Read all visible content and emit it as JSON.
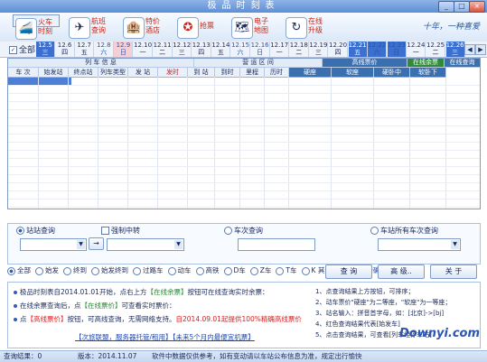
{
  "window": {
    "title": "极品时刻表"
  },
  "toolbar": [
    {
      "label": "火车\n时刻",
      "icon": "train-icon",
      "selected": true
    },
    {
      "label": "航班\n查询",
      "icon": "plane-icon"
    },
    {
      "label": "特价\n酒店",
      "icon": "hotel-icon"
    },
    {
      "label": "抢票",
      "icon": "ticket-icon"
    },
    {
      "label": "电子\n地图",
      "icon": "map-icon"
    },
    {
      "label": "在线\n升级",
      "icon": "upgrade-icon"
    }
  ],
  "brand_slogan": "十年，一种喜爱",
  "date_strip": {
    "all_label": "全部",
    "dates": [
      {
        "d": "12.5",
        "w": "三"
      },
      {
        "d": "12.6",
        "w": "四"
      },
      {
        "d": "12.7",
        "w": "五"
      },
      {
        "d": "12.8",
        "w": "六"
      },
      {
        "d": "12.9",
        "w": "日"
      },
      {
        "d": "12.10",
        "w": "一"
      },
      {
        "d": "12.11",
        "w": "二"
      },
      {
        "d": "12.12",
        "w": "三"
      },
      {
        "d": "12.13",
        "w": "四"
      },
      {
        "d": "12.14",
        "w": "五"
      },
      {
        "d": "12.15",
        "w": "六"
      },
      {
        "d": "12.16",
        "w": "日"
      },
      {
        "d": "12.17",
        "w": "一"
      },
      {
        "d": "12.18",
        "w": "二"
      },
      {
        "d": "12.19",
        "w": "三"
      },
      {
        "d": "12.20",
        "w": "四"
      },
      {
        "d": "12.21",
        "w": "五"
      },
      {
        "d": "12.22",
        "w": "六"
      },
      {
        "d": "12.23",
        "w": "日"
      },
      {
        "d": "12.24",
        "w": "一"
      },
      {
        "d": "12.25",
        "w": "二"
      },
      {
        "d": "12.26",
        "w": "三"
      }
    ]
  },
  "grid": {
    "groups": {
      "train": "列 车 信 息",
      "seg": "营 运 区 间",
      "price": "高线票价",
      "online": "在线余票",
      "query": "在线查询"
    },
    "columns": [
      "车 次",
      "始发站",
      "终点站",
      "列车类型",
      "发 站",
      "发时",
      "到 站",
      "到时",
      "里程",
      "历时",
      "硬座",
      "软座",
      "硬卧中",
      "软卧下"
    ]
  },
  "query": {
    "station_label": "站站查询",
    "force_transfer": "强制中转",
    "train_label": "车次查询",
    "station_all": "车站所有车次查询",
    "arrow": "→"
  },
  "filters": {
    "items": [
      "全部",
      "始发",
      "终到",
      "始发终到",
      "过路车",
      "动车",
      "高铁",
      "D车",
      "Z车",
      "T车",
      "K 其余车"
    ],
    "exact": "站名精确匹配"
  },
  "buttons": {
    "search": "查 询",
    "advanced": "高 级..",
    "close": "关 于"
  },
  "info": {
    "line1": {
      "a": "极品时刻表自2014.01.01开始，点右上方",
      "b": "【在线余票】",
      "c": "按钮可在线查询实时余票："
    },
    "line2": {
      "a": "在线余票查询后，点",
      "b": "【在线票价】",
      "c": "可查看实时票价："
    },
    "line3": {
      "a": "点",
      "b": "【高线票价】",
      "c": "按钮，可高线查询，无需网络支持。",
      "d": "自2014.09.01起提供100%精确高线票价"
    },
    "link1": "【次旅联盟，服务器托管/租用】",
    "link2": "【未来5个月内最便宜机票】",
    "tips": [
      "1、点查询结果上方按钮，可排序；",
      "2、动车票价\"硬座\"为二等座，\"软座\"为一等座；",
      "3、站名输入：拼音首字母，如：[北京]->[bj]",
      "4、红色查询结果代表[始发车]",
      "5、点击查询结果，可查看[列车经停车站]"
    ]
  },
  "status": {
    "results": "查询结果：0",
    "version": "版本：2014.11.07",
    "notice": "软件中数据仅供参考，如有变动请以车站公布信息为准，规定出行愉快"
  },
  "watermark": "Downyi.com"
}
